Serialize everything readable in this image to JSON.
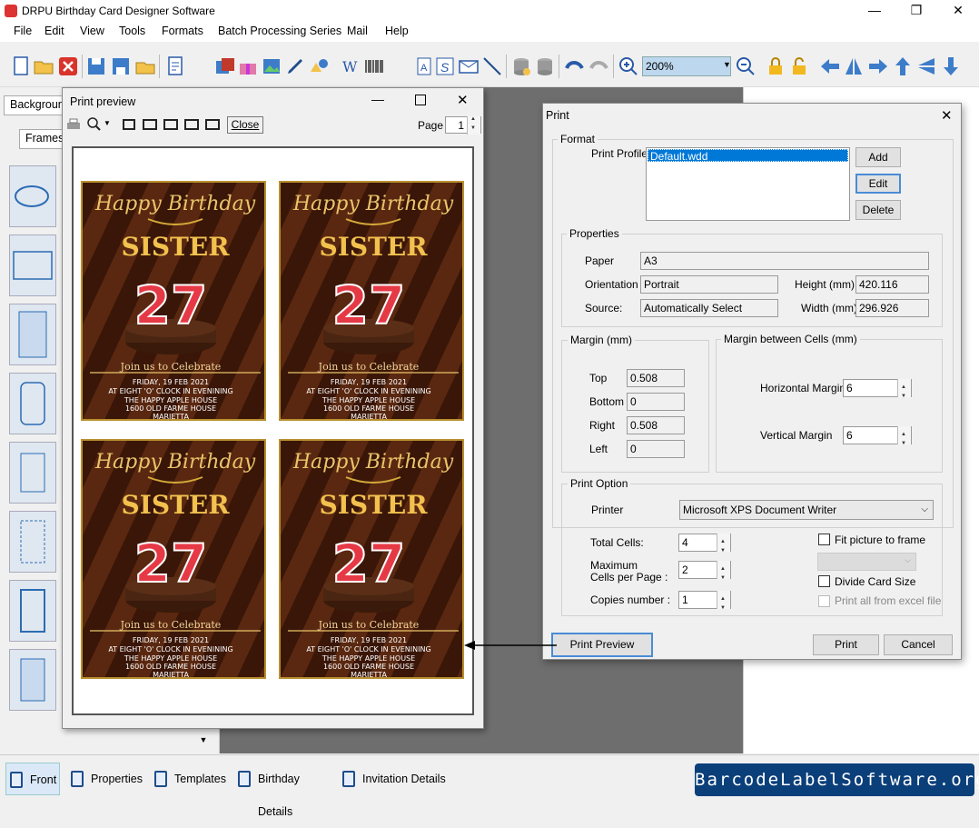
{
  "app": {
    "title": "DRPU Birthday Card Designer Software",
    "menu": [
      "File",
      "Edit",
      "View",
      "Tools",
      "Formats",
      "Batch Processing Series",
      "Mail",
      "Help"
    ],
    "zoom": "200%"
  },
  "left_panel": {
    "tab_background": "Backgroun",
    "tab_frames": "Frames"
  },
  "bottom_tabs": [
    "Front",
    "Properties",
    "Templates",
    "Birthday Details",
    "Invitation Details"
  ],
  "brand": "BarcodeLabelSoftware.org",
  "print_preview": {
    "title": "Print preview",
    "close_label": "Close",
    "page_label": "Page",
    "page_value": "1",
    "card": {
      "line1": "Happy Birthday",
      "name": "SISTER",
      "age": "27",
      "invite": "Join us to Celebrate",
      "details": [
        "FRIDAY, 19 FEB 2021",
        "AT EIGHT 'O' CLOCK IN EVENINING",
        "THE HAPPY APPLE HOUSE",
        "1600 OLD FARME HOUSE",
        "MARIETTA"
      ]
    }
  },
  "print_dialog": {
    "title": "Print",
    "format_group": "Format",
    "print_profile_label": "Print Profile",
    "profile_value": "Default.wdd",
    "add": "Add",
    "edit": "Edit",
    "delete": "Delete",
    "properties_group": "Properties",
    "paper_label": "Paper",
    "paper_value": "A3",
    "orientation_label": "Orientation",
    "orientation_value": "Portrait",
    "source_label": "Source:",
    "source_value": "Automatically Select",
    "height_label": "Height (mm)",
    "height_value": "420.116",
    "width_label": "Width (mm)",
    "width_value": "296.926",
    "margin_group": "Margin (mm)",
    "top_label": "Top",
    "top_value": "0.508",
    "bottom_label": "Bottom",
    "bottom_value": "0",
    "right_label": "Right",
    "right_value": "0.508",
    "left_label": "Left",
    "left_value": "0",
    "cells_group": "Margin between Cells (mm)",
    "hmargin_label": "Horizontal Margin",
    "hmargin_value": "6",
    "vmargin_label": "Vertical Margin",
    "vmargin_value": "6",
    "option_group": "Print Option",
    "printer_label": "Printer",
    "printer_value": "Microsoft XPS Document Writer",
    "total_cells_label": "Total Cells:",
    "total_cells_value": "4",
    "max_cells_label1": "Maximum",
    "max_cells_label2": "Cells per Page :",
    "max_cells_value": "2",
    "copies_label": "Copies number :",
    "copies_value": "1",
    "fit_picture_label": "Fit picture to frame",
    "divide_card_label": "Divide Card Size",
    "print_all_label": "Print all from excel file",
    "print_preview_btn": "Print Preview",
    "print_btn": "Print",
    "cancel_btn": "Cancel"
  }
}
